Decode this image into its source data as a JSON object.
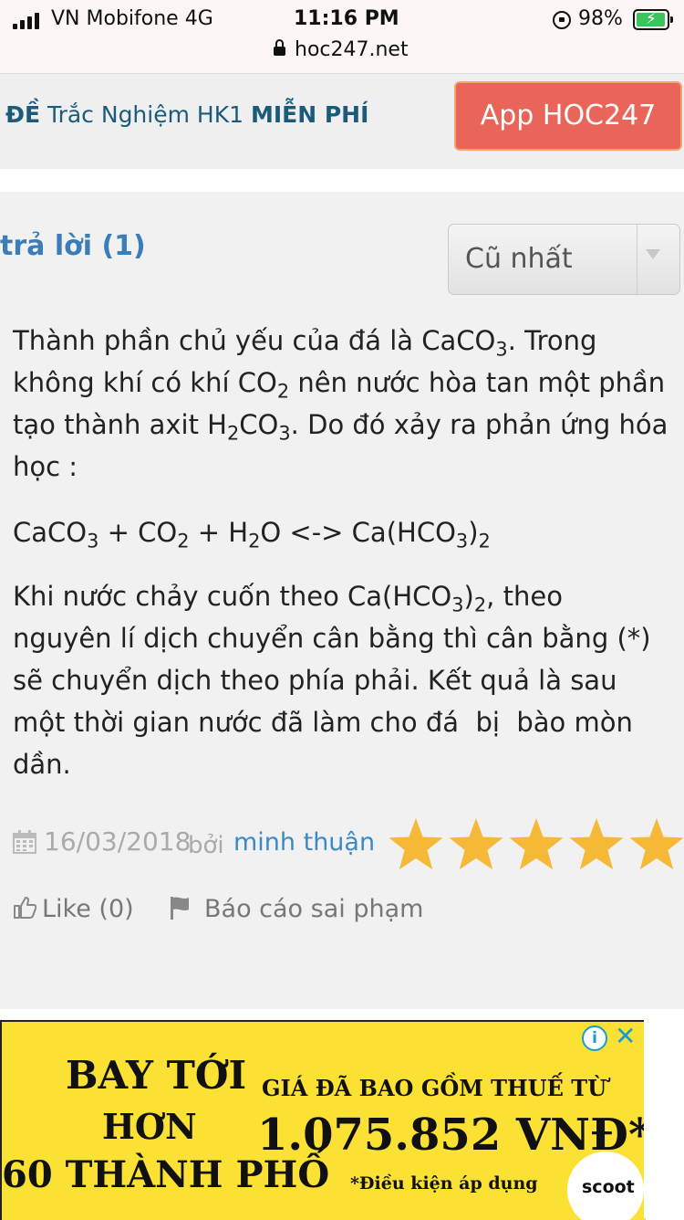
{
  "status_bar": {
    "carrier": "VN Mobifone  4G",
    "time": "11:16 PM",
    "battery": "98%",
    "url": "hoc247.net"
  },
  "promo": {
    "bold_left": "ĐỀ",
    "text": " Trắc Nghiệm HK1 ",
    "bold_right": "MIỄN PHÍ",
    "app_button": "App HOC247"
  },
  "answers": {
    "title": "trả lời (1)",
    "sort_selected": "Cũ nhất",
    "p1": {
      "a": "Thành phần chủ yếu của đá là CaCO",
      "s1": "3",
      "b": ". Trong không khí có khí CO",
      "s2": "2",
      "c": " nên nước hòa tan một phần tạo thành axit H",
      "s3": "2",
      "d": "CO",
      "s4": "3",
      "e": ". Do đó xảy ra phản ứng hóa học :"
    },
    "eq": {
      "a": "CaCO",
      "s1": "3",
      "b": " + CO",
      "s2": "2",
      "c": " + H",
      "s3": "2",
      "d": "O <-> Ca(HCO",
      "s4": "3",
      "e": ")",
      "s5": "2"
    },
    "p3": {
      "a": "Khi nước chảy cuốn theo Ca(HCO",
      "s1": "3",
      "b": ")",
      "s2": "2",
      "c": ", theo nguyên lí dịch chuyển cân bằng thì cân bằng (*) sẽ chuyển dịch theo phía phải. Kết quả là sau một thời gian nước đã làm cho đá  bị  bào mòn dần."
    },
    "meta": {
      "date": "16/03/2018",
      "by": "bởi",
      "author": "minh thuận",
      "rating": 5,
      "rating_max": 5,
      "star_color": "#f5b937"
    },
    "actions": {
      "like": "Like (0)",
      "report": "Báo cáo sai phạm"
    }
  },
  "ad": {
    "line1": "BAY TỚI",
    "line2": "HƠN",
    "line3": "60 THÀNH PHỐ",
    "sub": "GIÁ ĐÃ BAO GỒM THUẾ TỪ",
    "price": "1.075.852 VNĐ*",
    "condition": "*Điều kiện áp dụng",
    "brand": "scoot",
    "info": "i",
    "close": "✕"
  }
}
